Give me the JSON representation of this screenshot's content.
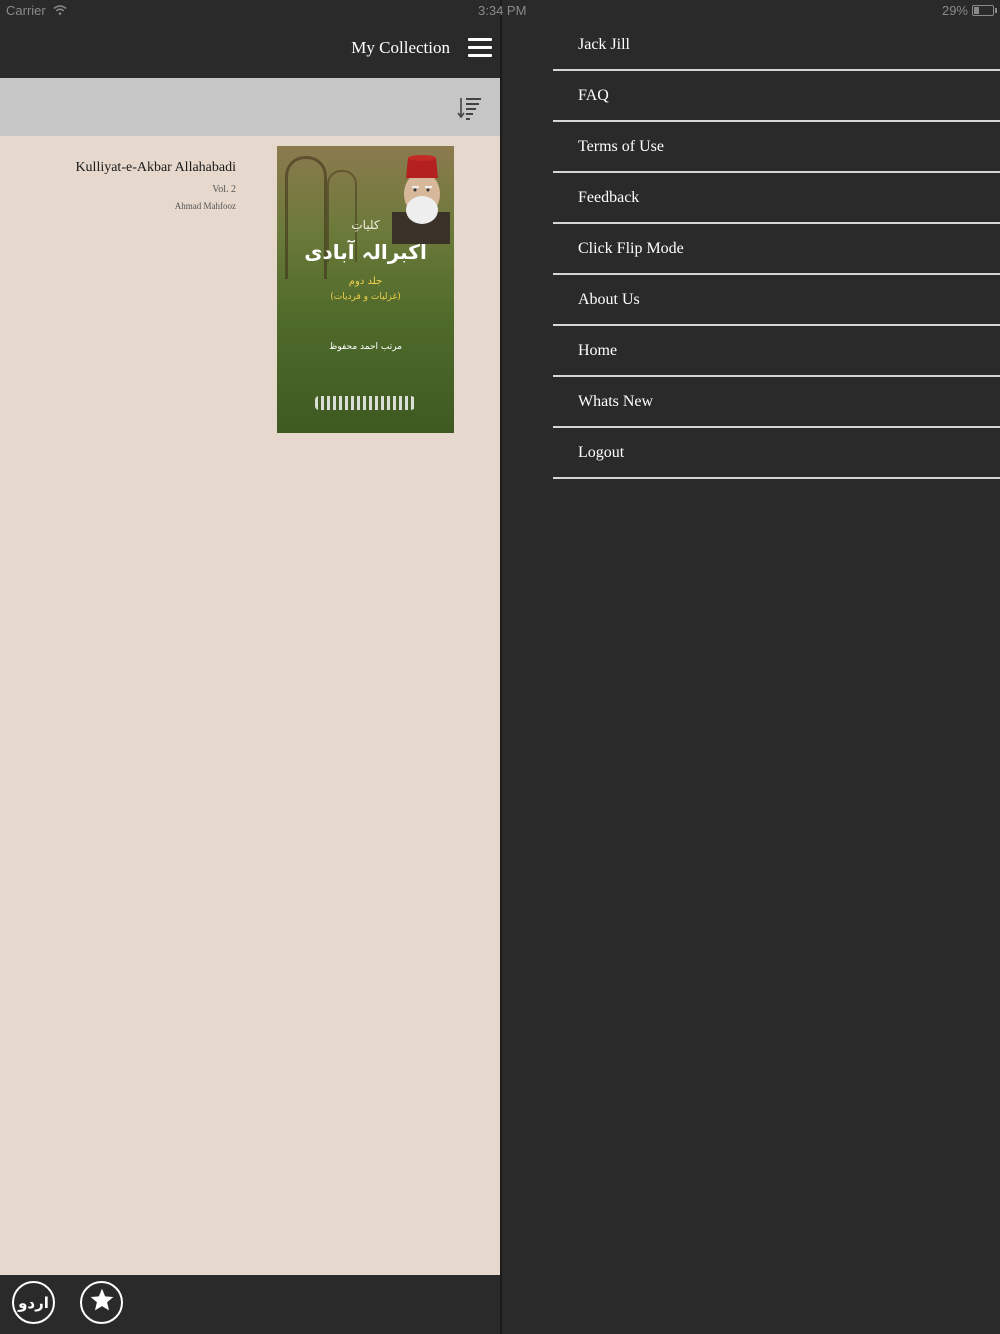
{
  "status_bar": {
    "carrier": "Carrier",
    "time": "3:34 PM",
    "battery": "29%",
    "battery_level": 0.29
  },
  "nav": {
    "title": "My Collection"
  },
  "books": [
    {
      "title": "Kulliyat-e-Akbar Allahabadi",
      "volume": "Vol. 2",
      "author": "Ahmad Mahfooz",
      "cover": {
        "line1": "کلیاتِ",
        "line2": "اکبرالہ آبادی",
        "line3": "جلد دوم",
        "line4": "(غزلیات و فردیات)",
        "line5": "مرتب احمد محفوظ"
      }
    }
  ],
  "bottom_bar": {
    "urdu_label": "اردو"
  },
  "side_menu": {
    "items": [
      "Jack Jill",
      "FAQ",
      "Terms of Use",
      "Feedback",
      "Click Flip Mode",
      "About Us",
      "Home",
      "Whats New",
      "Logout"
    ]
  }
}
